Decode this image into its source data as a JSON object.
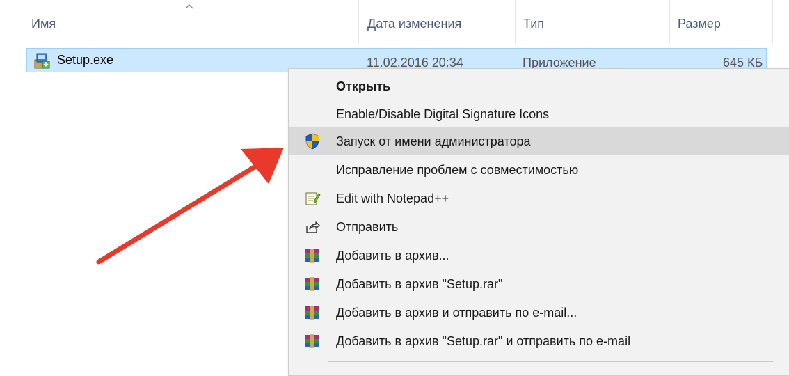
{
  "columns": {
    "name": "Имя",
    "date": "Дата изменения",
    "type": "Тип",
    "size": "Размер"
  },
  "file": {
    "name": "Setup.exe",
    "date": "11.02.2016 20:34",
    "type": "Приложение",
    "size": "645 КБ",
    "icon": "installer-icon"
  },
  "menu": {
    "items": [
      {
        "label": "Открыть",
        "icon": null
      },
      {
        "label": "Enable/Disable Digital Signature Icons",
        "icon": null
      },
      {
        "label": "Запуск от имени администратора",
        "icon": "uac-shield-icon"
      },
      {
        "label": "Исправление проблем с совместимостью",
        "icon": null
      },
      {
        "label": "Edit with Notepad++",
        "icon": "notepad-icon"
      },
      {
        "label": "Отправить",
        "icon": "share-icon"
      },
      {
        "label": "Добавить в архив...",
        "icon": "winrar-icon"
      },
      {
        "label": "Добавить в архив \"Setup.rar\"",
        "icon": "winrar-icon"
      },
      {
        "label": "Добавить в архив и отправить по e-mail...",
        "icon": "winrar-icon"
      },
      {
        "label": "Добавить в архив \"Setup.rar\" и отправить по e-mail",
        "icon": "winrar-icon"
      }
    ]
  },
  "colors": {
    "selection": "#cce8ff",
    "menu_bg": "#f2f2f2",
    "menu_highlight": "#d9d9d9",
    "arrow": "#e8392a"
  }
}
